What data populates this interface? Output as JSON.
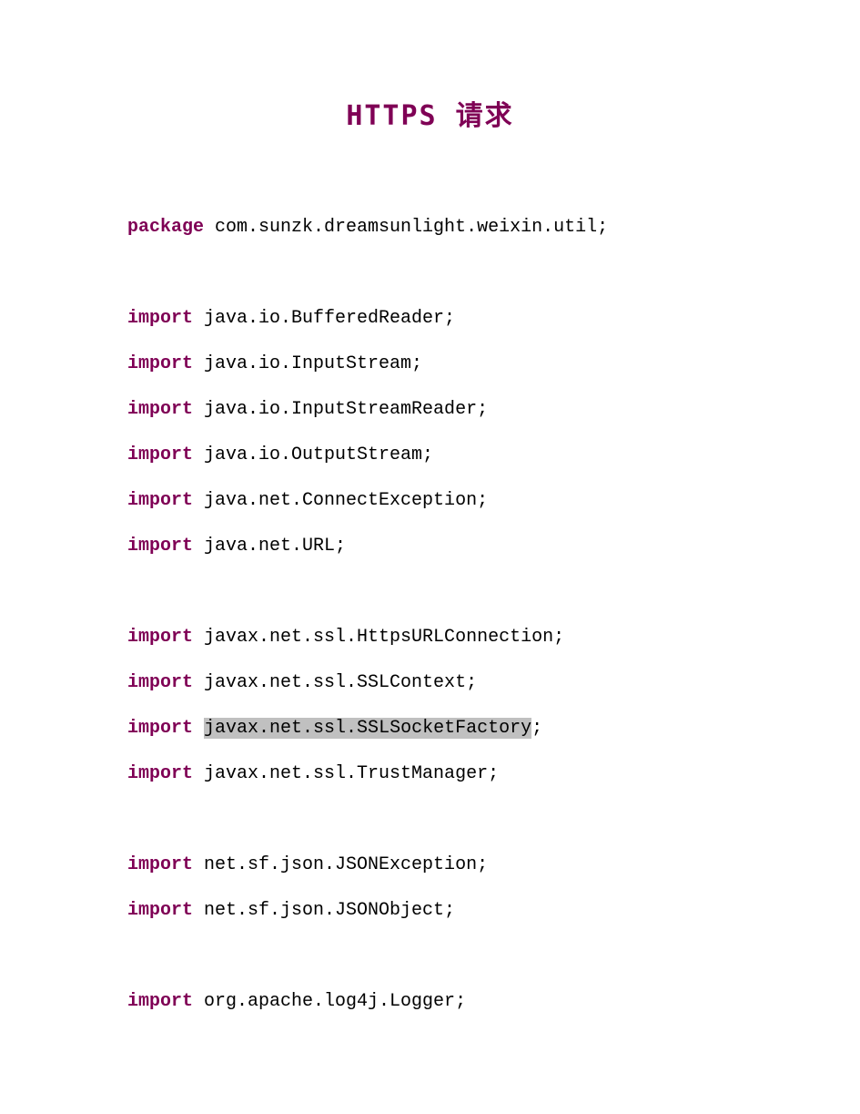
{
  "title": "HTTPS 请求",
  "lines": [
    {
      "type": "code",
      "keyword": "package",
      "rest": " com.sunzk.dreamsunlight.weixin.util;"
    },
    {
      "type": "blank"
    },
    {
      "type": "code",
      "keyword": "import",
      "rest": " java.io.BufferedReader;"
    },
    {
      "type": "code",
      "keyword": "import",
      "rest": " java.io.InputStream;"
    },
    {
      "type": "code",
      "keyword": "import",
      "rest": " java.io.InputStreamReader;"
    },
    {
      "type": "code",
      "keyword": "import",
      "rest": " java.io.OutputStream;"
    },
    {
      "type": "code",
      "keyword": "import",
      "rest": " java.net.ConnectException;"
    },
    {
      "type": "code",
      "keyword": "import",
      "rest": " java.net.URL;"
    },
    {
      "type": "blank"
    },
    {
      "type": "code",
      "keyword": "import",
      "rest": " javax.net.ssl.HttpsURLConnection;"
    },
    {
      "type": "code",
      "keyword": "import",
      "rest": " javax.net.ssl.SSLContext;"
    },
    {
      "type": "code",
      "keyword": "import",
      "prefix": " ",
      "highlight": "javax.net.ssl.SSLSocketFactory",
      "suffix": ";"
    },
    {
      "type": "code",
      "keyword": "import",
      "rest": " javax.net.ssl.TrustManager;"
    },
    {
      "type": "blank"
    },
    {
      "type": "code",
      "keyword": "import",
      "rest": " net.sf.json.JSONException;"
    },
    {
      "type": "code",
      "keyword": "import",
      "rest": " net.sf.json.JSONObject;"
    },
    {
      "type": "blank"
    },
    {
      "type": "code",
      "keyword": "import",
      "rest": " org.apache.log4j.Logger;"
    }
  ]
}
